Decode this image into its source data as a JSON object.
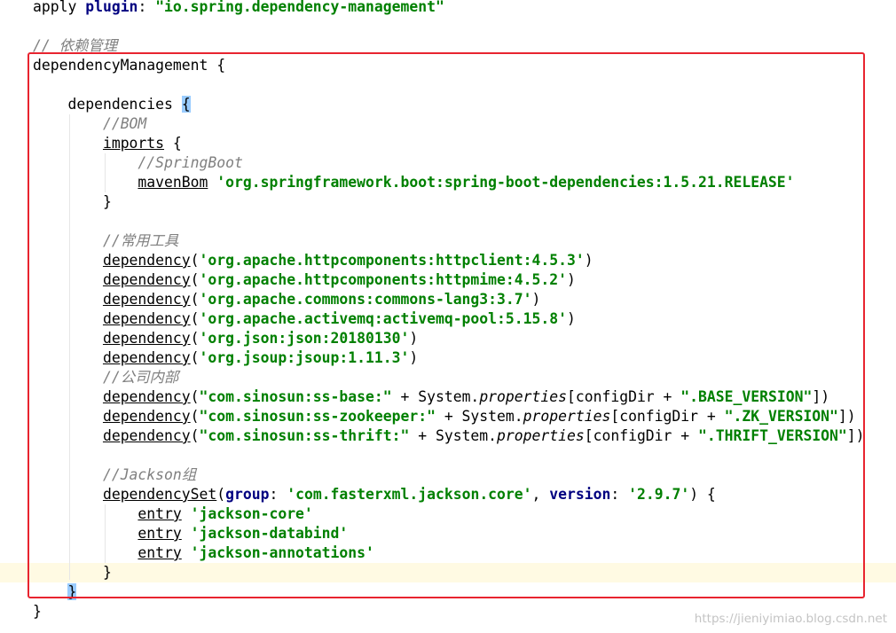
{
  "colors": {
    "keyword": "#000080",
    "string": "#008000",
    "comment": "#808080",
    "highlight_box": "#e8242f",
    "caret_line": "#fffae3",
    "brace_match": "#99ccff"
  },
  "caret_line_index": 29,
  "lines": [
    [
      {
        "t": "apply ",
        "s": "plain"
      },
      {
        "t": "plugin",
        "s": "kw"
      },
      {
        "t": ": ",
        "s": "plain"
      },
      {
        "t": "\"io.spring.dependency-management\"",
        "s": "str"
      }
    ],
    [],
    [
      {
        "t": "// 依赖管理",
        "s": "cm"
      }
    ],
    [
      {
        "t": "dependencyManagement {",
        "s": "plain"
      }
    ],
    [],
    [
      {
        "t": "    ",
        "s": "ws"
      },
      {
        "t": "dependencies ",
        "s": "plain"
      },
      {
        "t": "{",
        "s": "brace"
      }
    ],
    [
      {
        "t": "        ",
        "s": "ws"
      },
      {
        "t": "//BOM",
        "s": "cm"
      }
    ],
    [
      {
        "t": "        ",
        "s": "ws"
      },
      {
        "t": "imports",
        "s": "fn"
      },
      {
        "t": " {",
        "s": "plain"
      }
    ],
    [
      {
        "t": "            ",
        "s": "ws"
      },
      {
        "t": "//SpringBoot",
        "s": "cm"
      }
    ],
    [
      {
        "t": "            ",
        "s": "ws"
      },
      {
        "t": "mavenBom",
        "s": "fn"
      },
      {
        "t": " ",
        "s": "plain"
      },
      {
        "t": "'org.springframework.boot:spring-boot-dependencies:1.5.21.RELEASE'",
        "s": "str"
      }
    ],
    [
      {
        "t": "        ",
        "s": "ws"
      },
      {
        "t": "}",
        "s": "plain"
      }
    ],
    [],
    [
      {
        "t": "        ",
        "s": "ws"
      },
      {
        "t": "//常用工具",
        "s": "cm"
      }
    ],
    [
      {
        "t": "        ",
        "s": "ws"
      },
      {
        "t": "dependency",
        "s": "fn"
      },
      {
        "t": "(",
        "s": "plain"
      },
      {
        "t": "'org.apache.httpcomponents:httpclient:4.5.3'",
        "s": "str"
      },
      {
        "t": ")",
        "s": "plain"
      }
    ],
    [
      {
        "t": "        ",
        "s": "ws"
      },
      {
        "t": "dependency",
        "s": "fn"
      },
      {
        "t": "(",
        "s": "plain"
      },
      {
        "t": "'org.apache.httpcomponents:httpmime:4.5.2'",
        "s": "str"
      },
      {
        "t": ")",
        "s": "plain"
      }
    ],
    [
      {
        "t": "        ",
        "s": "ws"
      },
      {
        "t": "dependency",
        "s": "fn"
      },
      {
        "t": "(",
        "s": "plain"
      },
      {
        "t": "'org.apache.commons:commons-lang3:3.7'",
        "s": "str"
      },
      {
        "t": ")",
        "s": "plain"
      }
    ],
    [
      {
        "t": "        ",
        "s": "ws"
      },
      {
        "t": "dependency",
        "s": "fn"
      },
      {
        "t": "(",
        "s": "plain"
      },
      {
        "t": "'org.apache.activemq:activemq-pool:5.15.8'",
        "s": "str"
      },
      {
        "t": ")",
        "s": "plain"
      }
    ],
    [
      {
        "t": "        ",
        "s": "ws"
      },
      {
        "t": "dependency",
        "s": "fn"
      },
      {
        "t": "(",
        "s": "plain"
      },
      {
        "t": "'org.json:json:20180130'",
        "s": "str"
      },
      {
        "t": ")",
        "s": "plain"
      }
    ],
    [
      {
        "t": "        ",
        "s": "ws"
      },
      {
        "t": "dependency",
        "s": "fn"
      },
      {
        "t": "(",
        "s": "plain"
      },
      {
        "t": "'org.jsoup:jsoup:1.11.3'",
        "s": "str"
      },
      {
        "t": ")",
        "s": "plain"
      }
    ],
    [
      {
        "t": "        ",
        "s": "ws"
      },
      {
        "t": "//公司内部",
        "s": "cm"
      }
    ],
    [
      {
        "t": "        ",
        "s": "ws"
      },
      {
        "t": "dependency",
        "s": "fn"
      },
      {
        "t": "(",
        "s": "plain"
      },
      {
        "t": "\"com.sinosun:ss-base:\"",
        "s": "str"
      },
      {
        "t": " + System.",
        "s": "plain"
      },
      {
        "t": "properties",
        "s": "it"
      },
      {
        "t": "[configDir + ",
        "s": "plain"
      },
      {
        "t": "\".BASE_VERSION\"",
        "s": "str"
      },
      {
        "t": "])",
        "s": "plain"
      }
    ],
    [
      {
        "t": "        ",
        "s": "ws"
      },
      {
        "t": "dependency",
        "s": "fn"
      },
      {
        "t": "(",
        "s": "plain"
      },
      {
        "t": "\"com.sinosun:ss-zookeeper:\"",
        "s": "str"
      },
      {
        "t": " + System.",
        "s": "plain"
      },
      {
        "t": "properties",
        "s": "it"
      },
      {
        "t": "[configDir + ",
        "s": "plain"
      },
      {
        "t": "\".ZK_VERSION\"",
        "s": "str"
      },
      {
        "t": "])",
        "s": "plain"
      }
    ],
    [
      {
        "t": "        ",
        "s": "ws"
      },
      {
        "t": "dependency",
        "s": "fn"
      },
      {
        "t": "(",
        "s": "plain"
      },
      {
        "t": "\"com.sinosun:ss-thrift:\"",
        "s": "str"
      },
      {
        "t": " + System.",
        "s": "plain"
      },
      {
        "t": "properties",
        "s": "it"
      },
      {
        "t": "[configDir + ",
        "s": "plain"
      },
      {
        "t": "\".THRIFT_VERSION\"",
        "s": "str"
      },
      {
        "t": "])",
        "s": "plain"
      }
    ],
    [],
    [
      {
        "t": "        ",
        "s": "ws"
      },
      {
        "t": "//Jackson组",
        "s": "cm"
      }
    ],
    [
      {
        "t": "        ",
        "s": "ws"
      },
      {
        "t": "dependencySet",
        "s": "fn"
      },
      {
        "t": "(",
        "s": "plain"
      },
      {
        "t": "group",
        "s": "kw"
      },
      {
        "t": ": ",
        "s": "plain"
      },
      {
        "t": "'com.fasterxml.jackson.core'",
        "s": "str"
      },
      {
        "t": ", ",
        "s": "plain"
      },
      {
        "t": "version",
        "s": "kw"
      },
      {
        "t": ": ",
        "s": "plain"
      },
      {
        "t": "'2.9.7'",
        "s": "str"
      },
      {
        "t": ") {",
        "s": "plain"
      }
    ],
    [
      {
        "t": "            ",
        "s": "ws"
      },
      {
        "t": "entry",
        "s": "fn"
      },
      {
        "t": " ",
        "s": "plain"
      },
      {
        "t": "'jackson-core'",
        "s": "str"
      }
    ],
    [
      {
        "t": "            ",
        "s": "ws"
      },
      {
        "t": "entry",
        "s": "fn"
      },
      {
        "t": " ",
        "s": "plain"
      },
      {
        "t": "'jackson-databind'",
        "s": "str"
      }
    ],
    [
      {
        "t": "            ",
        "s": "ws"
      },
      {
        "t": "entry",
        "s": "fn"
      },
      {
        "t": " ",
        "s": "plain"
      },
      {
        "t": "'jackson-annotations'",
        "s": "str"
      }
    ],
    [
      {
        "t": "        ",
        "s": "ws"
      },
      {
        "t": "}",
        "s": "plain"
      }
    ],
    [
      {
        "t": "    ",
        "s": "ws"
      },
      {
        "t": "}",
        "s": "brace"
      }
    ],
    [
      {
        "t": "}",
        "s": "plain"
      }
    ]
  ],
  "watermark": "https://jieniyimiao.blog.csdn.net"
}
